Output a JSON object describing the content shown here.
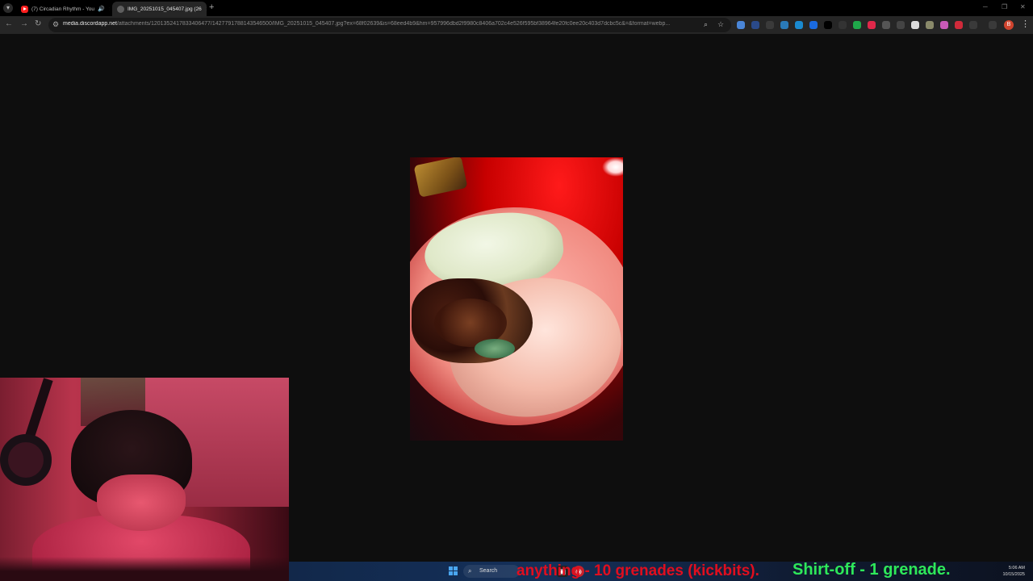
{
  "tabs": [
    {
      "title": "(7) Circadian Rhythm - You",
      "active": false
    },
    {
      "title": "IMG_20251015_045407.jpg (26",
      "active": true
    }
  ],
  "toolbar": {
    "url_domain": "media.discordapp.net",
    "url_rest": "/attachments/1201352417833406477/1427791788143546500/IMG_20251015_045407.jpg?ex=68f02639&is=68eed4b9&hm=957996dbd2f9980c8406a702c4e526f595bf38964fe20fc0ee20c403d7dcbc5c&=&format=webp..."
  },
  "taskbar": {
    "search_label": "Search",
    "time": "5:06 AM",
    "date": "10/15/2025"
  },
  "overlay": {
    "red_text": "anything - 10 grenades (kickbits).",
    "green_text": "Shirt-off -   1 grenade."
  },
  "icons": {
    "tab1_favicon": "youtube-icon",
    "tab2_favicon": "globe-icon"
  },
  "colors": {
    "overlay_red": "#e10e1e",
    "overlay_green": "#2ee85a",
    "page_background": "#0e0e0e"
  }
}
